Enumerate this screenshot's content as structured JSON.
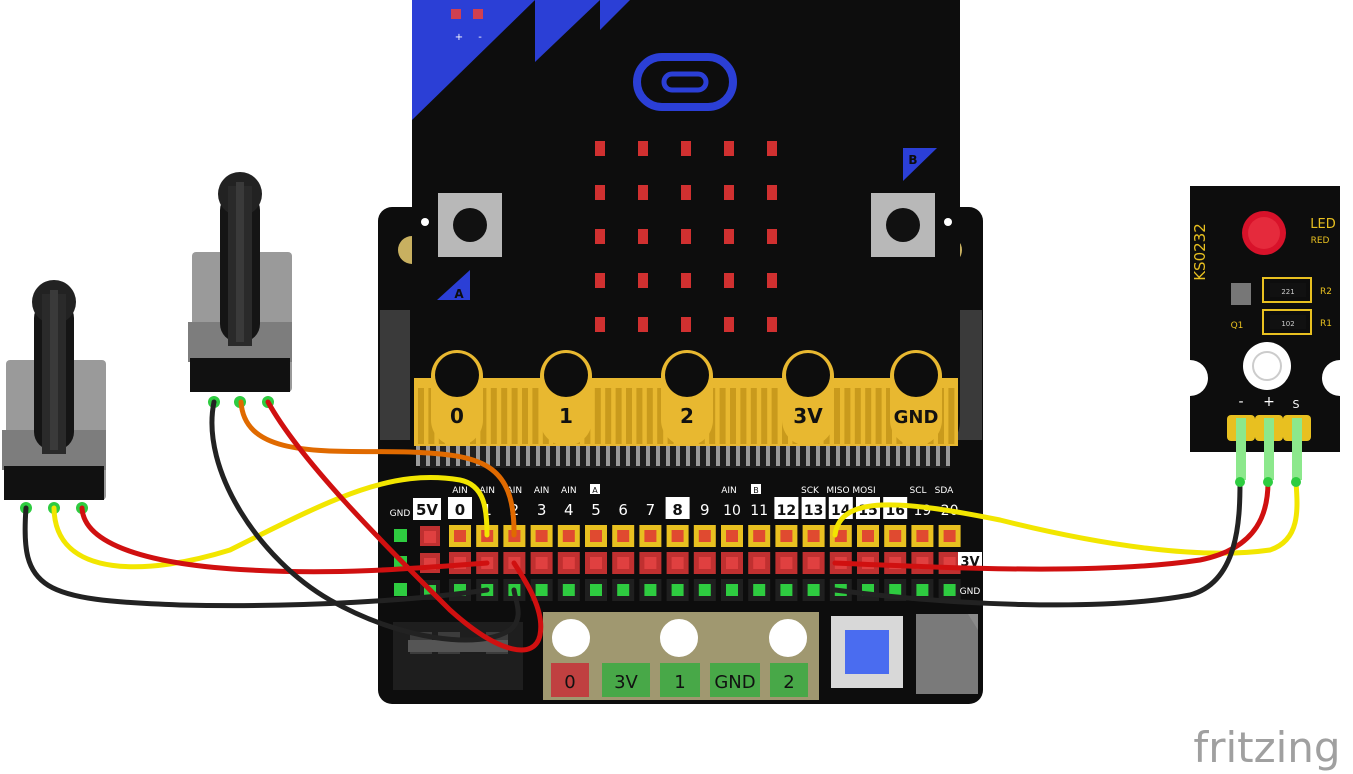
{
  "microbit": {
    "pin_labels": [
      "0",
      "1",
      "2",
      "3V",
      "GND"
    ],
    "power_labels": [
      "+",
      "-"
    ],
    "button_a": "A",
    "button_b": "B"
  },
  "shield": {
    "left_labels": [
      "GND",
      "5V"
    ],
    "ain_labels": [
      "AIN",
      "AIN",
      "AIN",
      "AIN",
      "AIN"
    ],
    "pin_numbers": [
      "0",
      "1",
      "2",
      "3",
      "4",
      "5",
      "6",
      "7",
      "8",
      "9",
      "10",
      "11",
      "12",
      "13",
      "14",
      "15",
      "16",
      "19",
      "20"
    ],
    "pin_a_tag": "A",
    "pin_b_tag": "B",
    "ain10": "AIN",
    "func_labels": [
      "SCK",
      "MISO",
      "MOSI",
      "SCL",
      "SDA"
    ],
    "rail_3v": "3V",
    "rail_gnd": "GND",
    "bottom_pads": [
      "0",
      "3V",
      "1",
      "GND",
      "2"
    ]
  },
  "led_module": {
    "model": "KS0232",
    "title": "LED",
    "color": "RED",
    "r2_label": "R2",
    "r1_label": "R1",
    "q1_label": "Q1",
    "r2_value": "221",
    "r1_value": "102",
    "pins": [
      "-",
      "+",
      "S"
    ]
  },
  "watermark": "fritzing",
  "colors": {
    "board": "#111111",
    "gold": "#E8B830",
    "blue_accent": "#2B3FD6",
    "wire_red": "#D01010",
    "wire_yellow": "#F2E600",
    "wire_black": "#222222",
    "wire_orange": "#E06A00",
    "header_yellow": "#E8C020",
    "pin_green": "#2ECC40"
  }
}
